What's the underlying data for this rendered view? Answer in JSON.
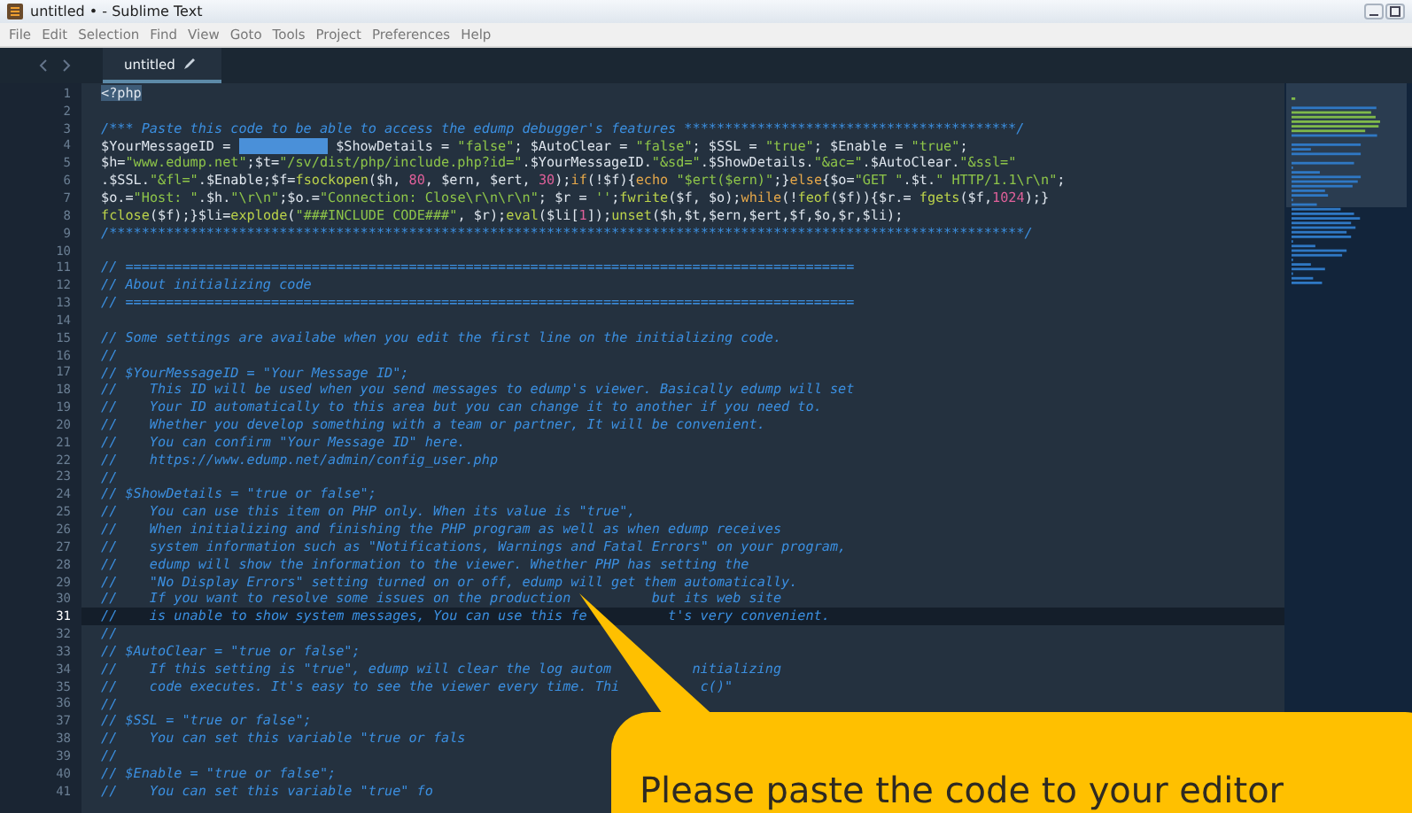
{
  "window": {
    "title": "untitled • - Sublime Text"
  },
  "menu": [
    "File",
    "Edit",
    "Selection",
    "Find",
    "View",
    "Goto",
    "Tools",
    "Project",
    "Preferences",
    "Help"
  ],
  "tabs": [
    {
      "label": "untitled",
      "selected": true
    }
  ],
  "lines": [
    {
      "number": "1",
      "current": false,
      "parts": [
        [
          {
            "kind": "selected",
            "text": "<?php"
          }
        ]
      ]
    },
    {
      "number": "2",
      "current": false
    },
    {
      "number": "3",
      "current": false,
      "parts": [
        [
          {
            "kind": "cmt",
            "text": "/*** Paste this code to be able to access the edump debugger's features *****************************************/"
          }
        ]
      ]
    },
    {
      "number": "4",
      "current": false,
      "parts": [
        [
          {
            "kind": "plain",
            "text": "$YourMessageID = "
          },
          {
            "kind": "redacted"
          },
          {
            "kind": "plain",
            "text": " $ShowDetails = "
          },
          {
            "kind": "str",
            "text": "\"false\""
          },
          {
            "kind": "plain",
            "text": "; $AutoClear = "
          },
          {
            "kind": "str",
            "text": "\"false\""
          },
          {
            "kind": "plain",
            "text": "; $SSL = "
          },
          {
            "kind": "str",
            "text": "\"true\""
          },
          {
            "kind": "plain",
            "text": "; $Enable = "
          },
          {
            "kind": "str",
            "text": "\"true\""
          },
          {
            "kind": "plain",
            "text": ";"
          }
        ]
      ]
    },
    {
      "number": "5",
      "current": false,
      "parts": [
        [
          {
            "kind": "plain",
            "text": "$h="
          },
          {
            "kind": "str",
            "text": "\"www.edump.net\""
          },
          {
            "kind": "plain",
            "text": ";$t="
          },
          {
            "kind": "str",
            "text": "\"/sv/dist/php/include.php?id=\""
          },
          {
            "kind": "plain",
            "text": ".$YourMessageID."
          },
          {
            "kind": "str",
            "text": "\"&sd=\""
          },
          {
            "kind": "plain",
            "text": ".$ShowDetails."
          },
          {
            "kind": "str",
            "text": "\"&ac=\""
          },
          {
            "kind": "plain",
            "text": ".$AutoClear."
          },
          {
            "kind": "str",
            "text": "\"&ssl=\""
          }
        ]
      ]
    },
    {
      "number": "6",
      "current": false,
      "parts": [
        [
          {
            "kind": "plain",
            "text": ".$SSL."
          },
          {
            "kind": "str",
            "text": "\"&fl=\""
          },
          {
            "kind": "plain",
            "text": ".$Enable;$f="
          },
          {
            "kind": "fn",
            "text": "fsockopen"
          },
          {
            "kind": "plain",
            "text": "($h, "
          },
          {
            "kind": "num",
            "text": "80"
          },
          {
            "kind": "plain",
            "text": ", $ern, $ert, "
          },
          {
            "kind": "num",
            "text": "30"
          },
          {
            "kind": "plain",
            "text": ");"
          },
          {
            "kind": "kw",
            "text": "if"
          },
          {
            "kind": "plain",
            "text": "(!$f){"
          },
          {
            "kind": "kw",
            "text": "echo"
          },
          {
            "kind": "str",
            "text": " \"$ert($ern)\""
          },
          {
            "kind": "plain",
            "text": ";}"
          },
          {
            "kind": "kw",
            "text": "else"
          },
          {
            "kind": "plain",
            "text": "{$o="
          },
          {
            "kind": "str",
            "text": "\"GET \""
          },
          {
            "kind": "plain",
            "text": ".$t."
          },
          {
            "kind": "str",
            "text": "\" HTTP/1.1\\r\\n\""
          },
          {
            "kind": "plain",
            "text": ";"
          }
        ]
      ]
    },
    {
      "number": "7",
      "current": false,
      "parts": [
        [
          {
            "kind": "plain",
            "text": "$o.="
          },
          {
            "kind": "str",
            "text": "\"Host: \""
          },
          {
            "kind": "plain",
            "text": ".$h."
          },
          {
            "kind": "str",
            "text": "\"\\r\\n\""
          },
          {
            "kind": "plain",
            "text": ";$o.="
          },
          {
            "kind": "str",
            "text": "\"Connection: Close\\r\\n\\r\\n\""
          },
          {
            "kind": "plain",
            "text": "; $r = "
          },
          {
            "kind": "str",
            "text": "''"
          },
          {
            "kind": "plain",
            "text": ";"
          },
          {
            "kind": "fn",
            "text": "fwrite"
          },
          {
            "kind": "plain",
            "text": "($f, $o);"
          },
          {
            "kind": "kw",
            "text": "while"
          },
          {
            "kind": "plain",
            "text": "(!"
          },
          {
            "kind": "fn",
            "text": "feof"
          },
          {
            "kind": "plain",
            "text": "($f)){$r.= "
          },
          {
            "kind": "fn",
            "text": "fgets"
          },
          {
            "kind": "plain",
            "text": "($f,"
          },
          {
            "kind": "num",
            "text": "1024"
          },
          {
            "kind": "plain",
            "text": ");}"
          }
        ]
      ]
    },
    {
      "number": "8",
      "current": false,
      "parts": [
        [
          {
            "kind": "fn",
            "text": "fclose"
          },
          {
            "kind": "plain",
            "text": "($f);}$li="
          },
          {
            "kind": "fn",
            "text": "explode"
          },
          {
            "kind": "plain",
            "text": "("
          },
          {
            "kind": "str",
            "text": "\"###INCLUDE CODE###\""
          },
          {
            "kind": "plain",
            "text": ", $r);"
          },
          {
            "kind": "fn",
            "text": "eval"
          },
          {
            "kind": "plain",
            "text": "($li["
          },
          {
            "kind": "num",
            "text": "1"
          },
          {
            "kind": "plain",
            "text": "]);"
          },
          {
            "kind": "fn",
            "text": "unset"
          },
          {
            "kind": "plain",
            "text": "($h,$t,$ern,$ert,$f,$o,$r,$li);"
          }
        ]
      ]
    },
    {
      "number": "9",
      "current": false,
      "parts": [
        [
          {
            "kind": "cmt",
            "text": "/*****************************************************************************************************************/"
          }
        ]
      ]
    },
    {
      "number": "10",
      "current": false
    },
    {
      "number": "11",
      "current": false,
      "parts": [
        [
          {
            "kind": "cmt",
            "text": "// =========================================================================================="
          }
        ]
      ]
    },
    {
      "number": "12",
      "current": false,
      "parts": [
        [
          {
            "kind": "cmt",
            "text": "// About initializing code"
          }
        ]
      ]
    },
    {
      "number": "13",
      "current": false,
      "parts": [
        [
          {
            "kind": "cmt",
            "text": "// =========================================================================================="
          }
        ]
      ]
    },
    {
      "number": "14",
      "current": false
    },
    {
      "number": "15",
      "current": false,
      "parts": [
        [
          {
            "kind": "cmt",
            "text": "// Some settings are availabe when you edit the first line on the initializing code."
          }
        ]
      ]
    },
    {
      "number": "16",
      "current": false,
      "parts": [
        [
          {
            "kind": "cmt",
            "text": "//"
          }
        ]
      ]
    },
    {
      "number": "17",
      "current": false,
      "parts": [
        [
          {
            "kind": "cmt",
            "text": "// $YourMessageID = \"Your Message ID\";"
          }
        ]
      ]
    },
    {
      "number": "18",
      "current": false,
      "parts": [
        [
          {
            "kind": "cmt",
            "text": "//    This ID will be used when you send messages to edump's viewer. Basically edump will set"
          }
        ]
      ]
    },
    {
      "number": "19",
      "current": false,
      "parts": [
        [
          {
            "kind": "cmt",
            "text": "//    Your ID automatically to this area but you can change it to another if you need to."
          }
        ]
      ]
    },
    {
      "number": "20",
      "current": false,
      "parts": [
        [
          {
            "kind": "cmt",
            "text": "//    Whether you develop something with a team or partner, It will be convenient."
          }
        ]
      ]
    },
    {
      "number": "21",
      "current": false,
      "parts": [
        [
          {
            "kind": "cmt",
            "text": "//    You can confirm \"Your Message ID\" here."
          }
        ]
      ]
    },
    {
      "number": "22",
      "current": false,
      "parts": [
        [
          {
            "kind": "cmt",
            "text": "//    https://www.edump.net/admin/config_user.php"
          }
        ]
      ]
    },
    {
      "number": "23",
      "current": false,
      "parts": [
        [
          {
            "kind": "cmt",
            "text": "//"
          }
        ]
      ]
    },
    {
      "number": "24",
      "current": false,
      "parts": [
        [
          {
            "kind": "cmt",
            "text": "// $ShowDetails = \"true or false\";"
          }
        ]
      ]
    },
    {
      "number": "25",
      "current": false,
      "parts": [
        [
          {
            "kind": "cmt",
            "text": "//    You can use this item on PHP only. When its value is \"true\","
          }
        ]
      ]
    },
    {
      "number": "26",
      "current": false,
      "parts": [
        [
          {
            "kind": "cmt",
            "text": "//    When initializing and finishing the PHP program as well as when edump receives"
          }
        ]
      ]
    },
    {
      "number": "27",
      "current": false,
      "parts": [
        [
          {
            "kind": "cmt",
            "text": "//    system information such as \"Notifications, Warnings and Fatal Errors\" on your program,"
          }
        ]
      ]
    },
    {
      "number": "28",
      "current": false,
      "parts": [
        [
          {
            "kind": "cmt",
            "text": "//    edump will show the information to the viewer. Whether PHP has setting the"
          }
        ]
      ]
    },
    {
      "number": "29",
      "current": false,
      "parts": [
        [
          {
            "kind": "cmt",
            "text": "//    \"No Display Errors\" setting turned on or off, edump will get them automatically."
          }
        ]
      ]
    },
    {
      "number": "30",
      "current": false,
      "parts": [
        [
          {
            "kind": "cmt",
            "text": "//    If you want to resolve some issues on the production"
          }
        ],
        [
          {
            "kind": "cmt",
            "text": "but its web site"
          }
        ]
      ]
    },
    {
      "number": "31",
      "current": true,
      "parts": [
        [
          {
            "kind": "cmt",
            "text": "//    is unable to show system messages, You can use this fe"
          }
        ],
        [
          {
            "kind": "cmt",
            "text": "t's very convenient."
          }
        ]
      ]
    },
    {
      "number": "32",
      "current": false,
      "parts": [
        [
          {
            "kind": "cmt",
            "text": "//"
          }
        ]
      ]
    },
    {
      "number": "33",
      "current": false,
      "parts": [
        [
          {
            "kind": "cmt",
            "text": "// $AutoClear = \"true or false\";"
          }
        ]
      ]
    },
    {
      "number": "34",
      "current": false,
      "parts": [
        [
          {
            "kind": "cmt",
            "text": "//    If this setting is \"true\", edump will clear the log autom"
          }
        ],
        [
          {
            "kind": "cmt",
            "text": "nitializing"
          }
        ]
      ]
    },
    {
      "number": "35",
      "current": false,
      "parts": [
        [
          {
            "kind": "cmt",
            "text": "//    code executes. It's easy to see the viewer every time. Thi"
          }
        ],
        [
          {
            "kind": "cmt",
            "text": "c()\""
          }
        ]
      ]
    },
    {
      "number": "36",
      "current": false,
      "parts": [
        [
          {
            "kind": "cmt",
            "text": "//"
          }
        ]
      ]
    },
    {
      "number": "37",
      "current": false,
      "parts": [
        [
          {
            "kind": "cmt",
            "text": "// $SSL = \"true or false\";"
          }
        ]
      ]
    },
    {
      "number": "38",
      "current": false,
      "parts": [
        [
          {
            "kind": "cmt",
            "text": "//    You can set this variable \"true or fals"
          }
        ]
      ]
    },
    {
      "number": "39",
      "current": false,
      "parts": [
        [
          {
            "kind": "cmt",
            "text": "//"
          }
        ]
      ]
    },
    {
      "number": "40",
      "current": false,
      "parts": [
        [
          {
            "kind": "cmt",
            "text": "// $Enable = \"true or false\";"
          }
        ]
      ]
    },
    {
      "number": "41",
      "current": false,
      "parts": [
        [
          {
            "kind": "cmt",
            "text": "//    You can set this variable \"true\" fo"
          }
        ]
      ]
    }
  ],
  "callout": {
    "text": "Please paste the code to your editor"
  }
}
